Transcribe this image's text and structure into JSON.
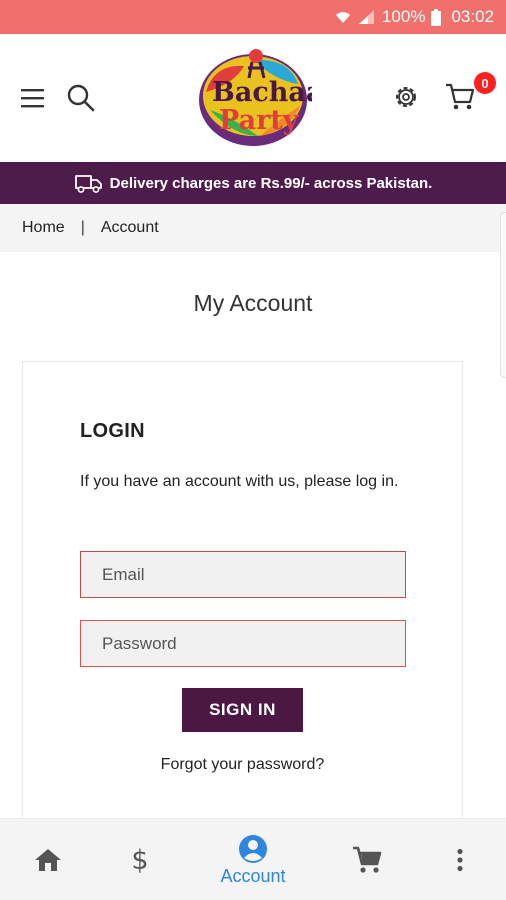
{
  "status_bar": {
    "battery": "100%",
    "time": "03:02"
  },
  "header": {
    "logo_alt": "Bachaa Party",
    "cart_count": "0"
  },
  "banner": {
    "text": "Delivery charges are Rs.99/- across Pakistan."
  },
  "breadcrumb": {
    "home": "Home",
    "separator": "|",
    "current": "Account"
  },
  "page": {
    "title": "My Account"
  },
  "login": {
    "heading": "LOGIN",
    "description": "If you have an account with us, please log in.",
    "email_placeholder": "Email",
    "password_placeholder": "Password",
    "submit_label": "SIGN IN",
    "forgot_label": "Forgot your password?"
  },
  "bottom_nav": {
    "items": [
      {
        "icon": "home-icon"
      },
      {
        "icon": "dollar-icon",
        "label": "$"
      },
      {
        "icon": "account-icon",
        "label": "Account",
        "active": true
      },
      {
        "icon": "cart-icon"
      },
      {
        "icon": "more-vertical-icon"
      }
    ]
  },
  "colors": {
    "status_bar": "#f0706c",
    "brand_purple": "#4d1c4b",
    "active_nav": "#2e86de",
    "badge": "#ff1f1f",
    "field_border": "#e05252"
  }
}
